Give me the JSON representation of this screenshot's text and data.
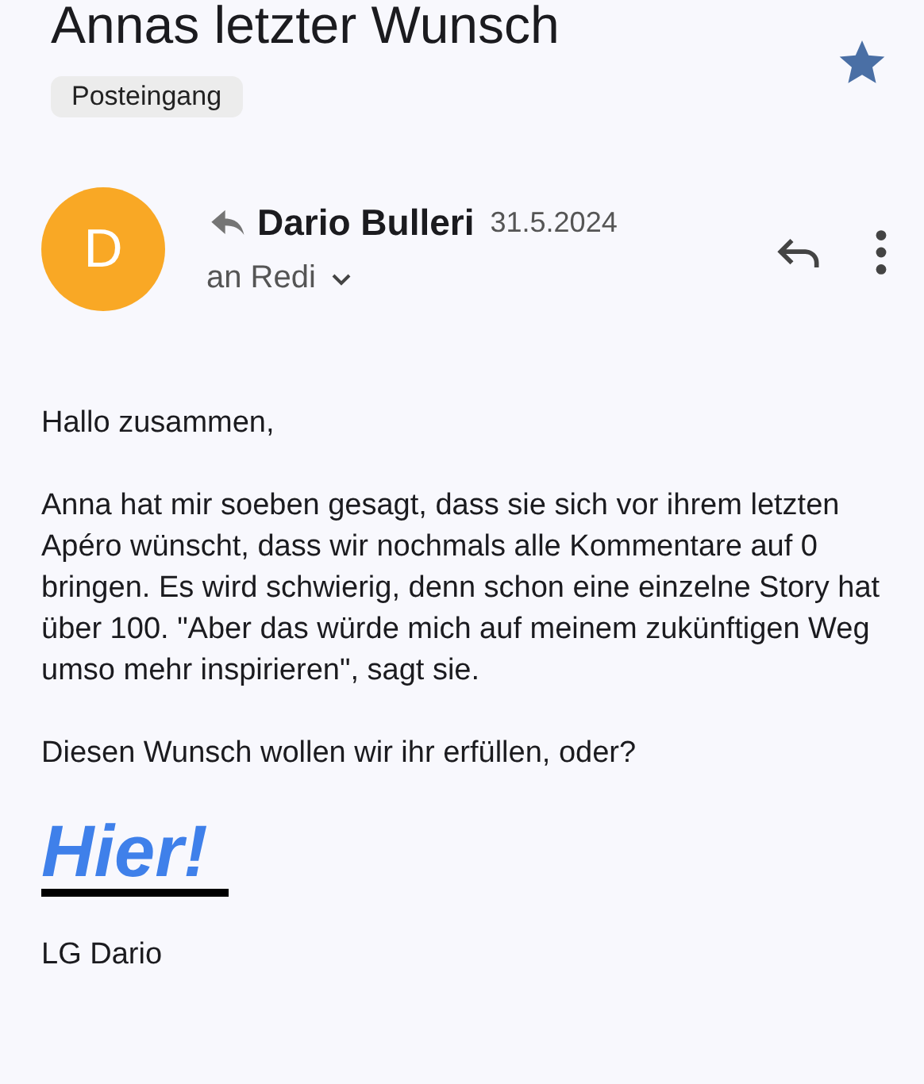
{
  "subject": "Annas letzter Wunsch",
  "starred": true,
  "label": "Posteingang",
  "message": {
    "avatar_letter": "D",
    "replied": true,
    "sender": "Dario Bulleri",
    "date": "31.5.2024",
    "recipient": "an Redi"
  },
  "body": {
    "greeting": "Hallo zusammen,",
    "paragraphs": [
      "Anna hat mir soeben gesagt, dass sie sich vor ihrem letzten Apéro wünscht, dass wir nochmals alle Kommentare auf 0 bringen. Es wird schwierig, denn schon eine einzelne Story hat über 100. \"Aber das würde mich auf meinem zukünftigen Weg umso mehr inspirieren\", sagt sie.",
      "Diesen Wunsch wollen wir ihr erfüllen, oder?"
    ],
    "link": "Hier! ",
    "signature": "LG Dario"
  }
}
